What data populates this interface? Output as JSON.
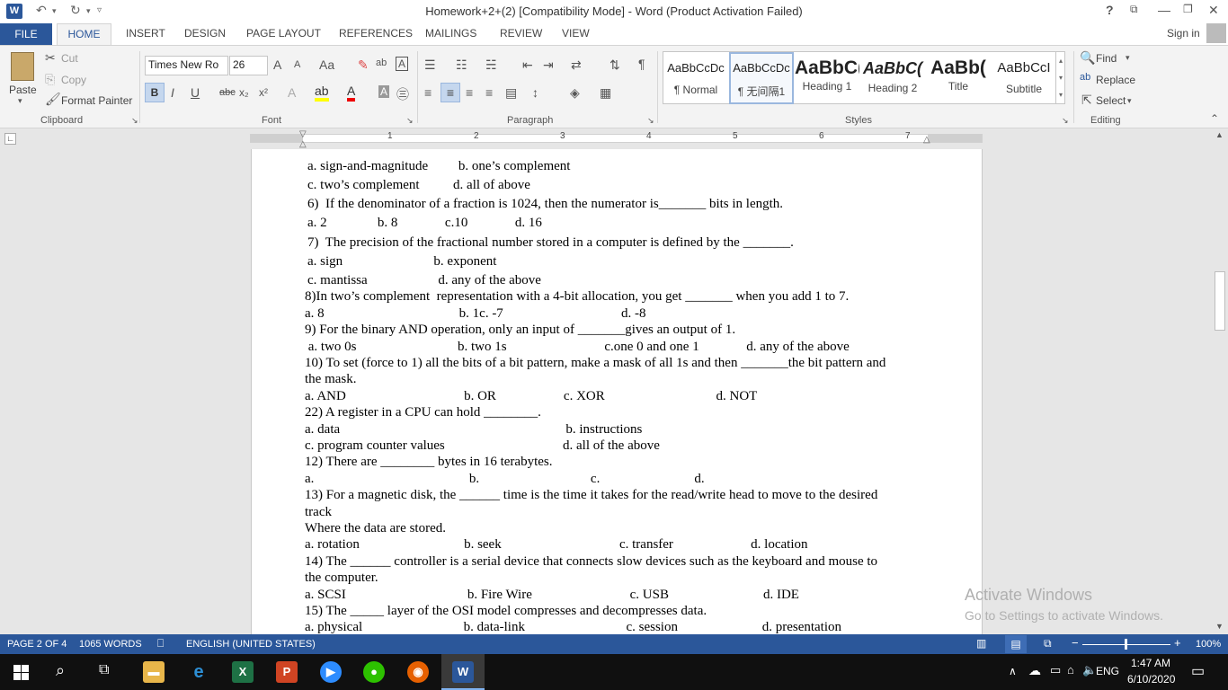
{
  "titlebar": {
    "app_icon": "W",
    "title": "Homework+2+(2) [Compatibility Mode] - Word (Product Activation Failed)",
    "help": "?",
    "undo_icon": "undo-icon",
    "redo_icon": "redo-icon"
  },
  "tabs": {
    "file": "FILE",
    "home": "HOME",
    "items": [
      "INSERT",
      "DESIGN",
      "PAGE LAYOUT",
      "REFERENCES",
      "MAILINGS",
      "REVIEW",
      "VIEW"
    ],
    "signin": "Sign in"
  },
  "clipboard": {
    "paste": "Paste",
    "cut": "Cut",
    "copy": "Copy",
    "format_painter": "Format Painter",
    "label": "Clipboard"
  },
  "font": {
    "name": "Times New Ro",
    "size": "26",
    "label": "Font",
    "bold": "B",
    "italic": "I",
    "underline": "U",
    "strike": "abc",
    "sub": "x₂",
    "sup": "x²"
  },
  "paragraph": {
    "label": "Paragraph"
  },
  "styles": {
    "label": "Styles",
    "items": [
      {
        "preview": "AaBbCcDc",
        "name": "¶ Normal"
      },
      {
        "preview": "AaBbCcDc",
        "name": "¶ 无间隔1"
      },
      {
        "preview": "AaBbC(",
        "name": "Heading 1"
      },
      {
        "preview": "AaBbC(",
        "name": "Heading 2"
      },
      {
        "preview": "AaBb(",
        "name": "Title"
      },
      {
        "preview": "AaBbCcI",
        "name": "Subtitle"
      }
    ]
  },
  "editing": {
    "find": "Find",
    "replace": "Replace",
    "select": "Select",
    "label": "Editing"
  },
  "ruler": {
    "numbers": [
      "1",
      "2",
      "3",
      "4",
      "5",
      "6",
      "7"
    ]
  },
  "document": {
    "lines": [
      "a. sign-and-magnitude         b. one’s complement",
      "c. two’s complement          d. all of above",
      "6)  If the denominator of a fraction is 1024, then the numerator is_______ bits in length.",
      "a. 2               b. 8              c.10              d. 16",
      "7)  The precision of the fractional number stored in a computer is defined by the _______.",
      "a. sign                           b. exponent",
      "c. mantissa                     d. any of the above",
      "8)In two’s complement  representation with a 4-bit allocation, you get _______ when you add 1 to 7.",
      "a. 8                                        b. 1c. -7                                   d. -8",
      "9) For the binary AND operation, only an input of _______gives an output of 1.",
      " a. two 0s                              b. two 1s                             c.one 0 and one 1              d. any of the above",
      "10) To set (force to 1) all the bits of a bit pattern, make a mask of all 1s and then _______the bit pattern and",
      "the mask.",
      "a. AND                                   b. OR                    c. XOR                                 d. NOT",
      "22) A register in a CPU can hold ________.",
      "a. data                                                                   b. instructions",
      "c. program counter values                                   d. all of the above",
      "12) There are ________ bytes in 16 terabytes.",
      "a.                                              b.                                 c.                            d.",
      "13) For a magnetic disk, the ______ time is the time it takes for the read/write head to move to the desired",
      "track",
      "Where the data are stored.",
      "a. rotation                               b. seek                                   c. transfer                       d. location",
      "14) The ______ controller is a serial device that connects slow devices such as the keyboard and mouse to",
      "the computer.",
      "a. SCSI                                    b. Fire Wire                             c. USB                            d. IDE",
      "15) The _____ layer of the OSI model compresses and decompresses data.",
      "a. physical                              b. data-link                              c. session                         d. presentation"
    ]
  },
  "watermark": {
    "line1": "Activate Windows",
    "line2": "Go to Settings to activate Windows."
  },
  "status": {
    "page": "PAGE 2 OF 4",
    "words": "1065 WORDS",
    "language": "ENGLISH (UNITED STATES)",
    "zoom": "100%"
  },
  "taskbar": {
    "lang": "ENG",
    "time": "1:47 AM",
    "date": "6/10/2020"
  }
}
